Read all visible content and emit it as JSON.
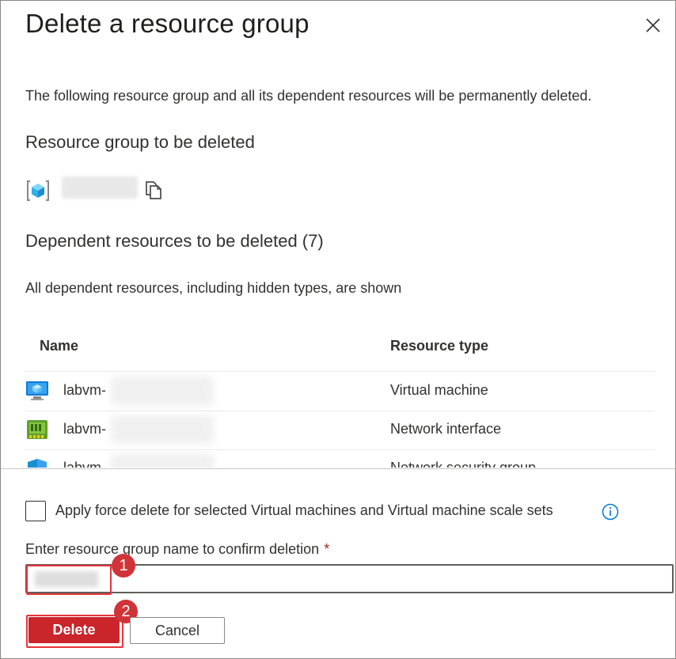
{
  "dialog": {
    "title": "Delete a resource group",
    "description": "The following resource group and all its dependent resources will be permanently deleted."
  },
  "resource_group": {
    "heading": "Resource group to be deleted",
    "icon": "resource-group-icon",
    "copy_icon": "copy-icon"
  },
  "dependents": {
    "heading": "Dependent resources to be deleted (7)",
    "note": "All dependent resources, including hidden types, are shown",
    "columns": [
      "Name",
      "Resource type"
    ],
    "rows": [
      {
        "name": "labvm-",
        "type": "Virtual machine",
        "icon": "virtual-machine-icon"
      },
      {
        "name": "labvm-",
        "type": "Network interface",
        "icon": "network-interface-icon"
      },
      {
        "name": "labvm-",
        "type": "Network security group",
        "icon": "network-security-group-icon"
      }
    ]
  },
  "force_delete": {
    "label": "Apply force delete for selected Virtual machines and Virtual machine scale sets",
    "checked": false
  },
  "confirm": {
    "label": "Enter resource group name to confirm deletion",
    "required_mark": "*"
  },
  "badges": [
    "1",
    "2"
  ],
  "buttons": {
    "delete": "Delete",
    "cancel": "Cancel"
  },
  "colors": {
    "danger": "#c9252b",
    "highlight": "#e8333a",
    "badge": "#d13438",
    "info": "#0078d4"
  }
}
